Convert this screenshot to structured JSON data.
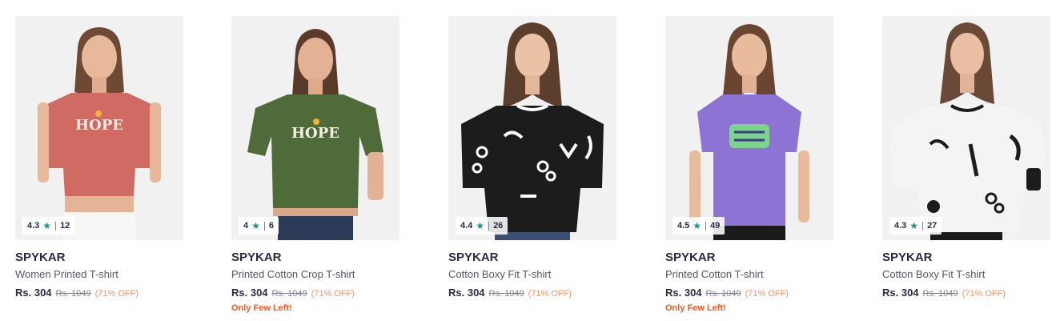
{
  "products": [
    {
      "rating": "4.3",
      "rating_count": "12",
      "brand": "SPYKAR",
      "name": "Women Printed T-shirt",
      "price": "Rs. 304",
      "mrp": "Rs. 1049",
      "discount": "(71% OFF)",
      "stock_note": "",
      "shirt_color": "#cf6b62",
      "print_text": "HOPE",
      "print_color": "#f5ede2"
    },
    {
      "rating": "4",
      "rating_count": "6",
      "brand": "SPYKAR",
      "name": "Printed Cotton Crop T-shirt",
      "price": "Rs. 304",
      "mrp": "Rs. 1049",
      "discount": "(71% OFF)",
      "stock_note": "Only Few Left!",
      "shirt_color": "#4f6b3a",
      "print_text": "HOPE",
      "print_color": "#f5ede2"
    },
    {
      "rating": "4.4",
      "rating_count": "26",
      "brand": "SPYKAR",
      "name": "Cotton Boxy Fit T-shirt",
      "price": "Rs. 304",
      "mrp": "Rs. 1049",
      "discount": "(71% OFF)",
      "stock_note": "",
      "shirt_color": "#1c1c1c",
      "print_text": "",
      "print_color": "#ffffff"
    },
    {
      "rating": "4.5",
      "rating_count": "49",
      "brand": "SPYKAR",
      "name": "Printed Cotton T-shirt",
      "price": "Rs. 304",
      "mrp": "Rs. 1049",
      "discount": "(71% OFF)",
      "stock_note": "Only Few Left!",
      "shirt_color": "#8d73d3",
      "print_text": "",
      "print_color": "#7bd48a"
    },
    {
      "rating": "4.3",
      "rating_count": "27",
      "brand": "SPYKAR",
      "name": "Cotton Boxy Fit T-shirt",
      "price": "Rs. 304",
      "mrp": "Rs. 1049",
      "discount": "(71% OFF)",
      "stock_note": "",
      "shirt_color": "#f4f4f4",
      "print_text": "",
      "print_color": "#1c1c1c"
    }
  ],
  "colors": {
    "rating_star": "#14958f",
    "discount": "#ff905a",
    "stock_note": "#ff5722"
  }
}
